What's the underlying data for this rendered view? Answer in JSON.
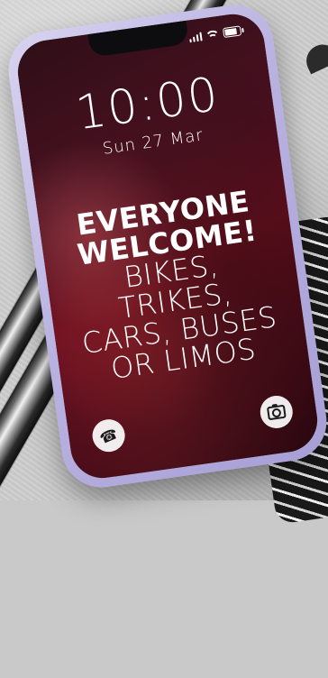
{
  "lockscreen": {
    "time": "10:00",
    "date": "Sun 27 Mar",
    "headline_lines": [
      "EVERYONE",
      "WELCOME!",
      "BIKES, TRIKES,",
      "CARS, BUSES",
      "OR LIMOS"
    ]
  },
  "icons": {
    "bottom_left": "phone-icon",
    "bottom_right": "camera-icon"
  },
  "colors": {
    "frame_lavender": "#b9b2e1",
    "screen_red": "#6a1020"
  }
}
